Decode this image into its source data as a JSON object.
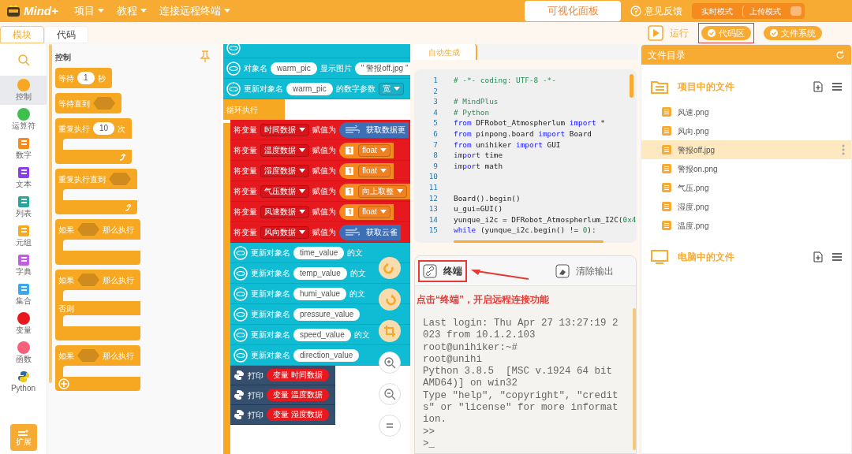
{
  "menu_bar": {
    "logo": "Mind+",
    "menus": [
      "项目",
      "教程",
      "连接远程终端"
    ],
    "panel_button": "可视化面板",
    "feedback": "意见反馈",
    "modes": [
      {
        "label": "实时模式",
        "selected": false
      },
      {
        "label": "上传模式",
        "selected": false
      }
    ]
  },
  "tabs": [
    {
      "label": "模块",
      "selected": true
    },
    {
      "label": "代码",
      "selected": false
    }
  ],
  "toolbar": {
    "run": "运行",
    "toggles": [
      {
        "label": "代码区",
        "on": true,
        "highlighted": true
      },
      {
        "label": "文件系统",
        "on": true,
        "highlighted": false
      }
    ]
  },
  "categories": [
    {
      "label": "控制",
      "kind": "dot",
      "color": "#f7a823",
      "selected": true
    },
    {
      "label": "运算符",
      "kind": "dot",
      "color": "#3fbf4f",
      "selected": false
    },
    {
      "label": "数字",
      "kind": "icon",
      "color": "#f58a1f",
      "selected": false
    },
    {
      "label": "文本",
      "kind": "icon",
      "color": "#8b3ee8",
      "selected": false
    },
    {
      "label": "列表",
      "kind": "icon",
      "color": "#2aa59a",
      "selected": false
    },
    {
      "label": "元组",
      "kind": "icon",
      "color": "#f7a823",
      "selected": false
    },
    {
      "label": "字典",
      "kind": "icon",
      "color": "#c060e0",
      "selected": false
    },
    {
      "label": "集合",
      "kind": "icon",
      "color": "#3aa8f0",
      "selected": false
    },
    {
      "label": "变量",
      "kind": "dot",
      "color": "#e8191e",
      "selected": false
    },
    {
      "label": "函数",
      "kind": "dot",
      "color": "#f7607a",
      "selected": false
    },
    {
      "label": "Python",
      "kind": "python",
      "color": "#2f6a9a",
      "selected": false
    }
  ],
  "extensions_button": "扩展",
  "palette": {
    "title": "控制",
    "blocks": [
      {
        "kind": "simple",
        "parts": [
          {
            "kind": "label",
            "text": "等待"
          },
          {
            "kind": "pill",
            "text": "1"
          },
          {
            "kind": "label",
            "text": "秒"
          }
        ]
      },
      {
        "kind": "simple",
        "parts": [
          {
            "kind": "label",
            "text": "等待直到"
          },
          {
            "kind": "hex"
          }
        ]
      },
      {
        "kind": "loop",
        "parts": [
          {
            "kind": "label",
            "text": "重复执行"
          },
          {
            "kind": "pill",
            "text": "10"
          },
          {
            "kind": "label",
            "text": "次"
          }
        ]
      },
      {
        "kind": "loop",
        "parts": [
          {
            "kind": "label",
            "text": "重复执行直到"
          },
          {
            "kind": "hex"
          }
        ]
      },
      {
        "kind": "if",
        "parts": [
          {
            "kind": "label",
            "text": "如果"
          },
          {
            "kind": "hex"
          },
          {
            "kind": "label",
            "text": "那么执行"
          }
        ]
      },
      {
        "kind": "ifelse",
        "parts": [
          {
            "kind": "label",
            "text": "如果"
          },
          {
            "kind": "hex"
          },
          {
            "kind": "label",
            "text": "那么执行"
          }
        ],
        "else": "否则"
      },
      {
        "kind": "ifplus",
        "parts": [
          {
            "kind": "label",
            "text": "如果"
          },
          {
            "kind": "hex"
          },
          {
            "kind": "label",
            "text": "那么执行"
          }
        ]
      }
    ]
  },
  "workspace": {
    "blocks": [
      {
        "kind": "cyan"
      },
      {
        "kind": "cyan",
        "parts": [
          {
            "kind": "label",
            "text": "对象名"
          },
          {
            "kind": "pill",
            "text": "warm_pic"
          },
          {
            "kind": "label",
            "text": "显示图片"
          },
          {
            "kind": "pill",
            "text": "\" 警报off.jpg \""
          }
        ]
      },
      {
        "kind": "cyan",
        "parts": [
          {
            "kind": "label",
            "text": "更新对象名"
          },
          {
            "kind": "pill",
            "text": "warm_pic"
          },
          {
            "kind": "label",
            "text": "的数字参数"
          },
          {
            "kind": "dropdown",
            "text": "宽"
          }
        ]
      },
      {
        "kind": "hat",
        "parts": [
          {
            "kind": "label",
            "text": "循环执行"
          }
        ]
      },
      {
        "kind": "red",
        "parts": [
          {
            "kind": "label",
            "text": "将变量"
          },
          {
            "kind": "dropdown",
            "text": "时间数据"
          },
          {
            "kind": "label",
            "text": "赋值为"
          },
          {
            "kind": "reporter",
            "text": "获取数据更"
          }
        ]
      },
      {
        "kind": "red",
        "parts": [
          {
            "kind": "label",
            "text": "将变量"
          },
          {
            "kind": "dropdown",
            "text": "温度数据"
          },
          {
            "kind": "label",
            "text": "赋值为"
          },
          {
            "kind": "number",
            "text": "float"
          }
        ]
      },
      {
        "kind": "red",
        "parts": [
          {
            "kind": "label",
            "text": "将变量"
          },
          {
            "kind": "dropdown",
            "text": "湿度数据"
          },
          {
            "kind": "label",
            "text": "赋值为"
          },
          {
            "kind": "number",
            "text": "float"
          }
        ]
      },
      {
        "kind": "red",
        "parts": [
          {
            "kind": "label",
            "text": "将变量"
          },
          {
            "kind": "dropdown",
            "text": "气压数据"
          },
          {
            "kind": "label",
            "text": "赋值为"
          },
          {
            "kind": "number",
            "text": "向上取整"
          }
        ]
      },
      {
        "kind": "red",
        "parts": [
          {
            "kind": "label",
            "text": "将变量"
          },
          {
            "kind": "dropdown",
            "text": "风速数据"
          },
          {
            "kind": "label",
            "text": "赋值为"
          },
          {
            "kind": "number",
            "text": "float"
          }
        ]
      },
      {
        "kind": "red",
        "parts": [
          {
            "kind": "label",
            "text": "将变量"
          },
          {
            "kind": "dropdown",
            "text": "风向数据"
          },
          {
            "kind": "label",
            "text": "赋值为"
          },
          {
            "kind": "reporter",
            "text": "获取云雀"
          }
        ]
      },
      {
        "kind": "cyan2",
        "parts": [
          {
            "kind": "label",
            "text": "更新对象名"
          },
          {
            "kind": "pill",
            "text": "time_value"
          },
          {
            "kind": "label",
            "text": "的文"
          }
        ]
      },
      {
        "kind": "cyan2",
        "parts": [
          {
            "kind": "label",
            "text": "更新对象名"
          },
          {
            "kind": "pill",
            "text": "temp_value"
          },
          {
            "kind": "label",
            "text": "的文"
          }
        ]
      },
      {
        "kind": "cyan2",
        "parts": [
          {
            "kind": "label",
            "text": "更新对象名"
          },
          {
            "kind": "pill",
            "text": "humi_value"
          },
          {
            "kind": "label",
            "text": "的文"
          }
        ]
      },
      {
        "kind": "cyan2",
        "parts": [
          {
            "kind": "label",
            "text": "更新对象名"
          },
          {
            "kind": "pill",
            "text": "pressure_value"
          }
        ]
      },
      {
        "kind": "cyan2",
        "parts": [
          {
            "kind": "label",
            "text": "更新对象名"
          },
          {
            "kind": "pill",
            "text": "speed_value"
          },
          {
            "kind": "label",
            "text": "的文"
          }
        ]
      },
      {
        "kind": "cyan2",
        "parts": [
          {
            "kind": "label",
            "text": "更新对象名"
          },
          {
            "kind": "pill",
            "text": "direction_value"
          }
        ]
      },
      {
        "kind": "print",
        "parts": [
          {
            "kind": "label",
            "text": "打印"
          },
          {
            "kind": "var",
            "text": "变量 时间数据"
          }
        ]
      },
      {
        "kind": "print",
        "parts": [
          {
            "kind": "label",
            "text": "打印"
          },
          {
            "kind": "var",
            "text": "变量 温度数据"
          }
        ]
      },
      {
        "kind": "print",
        "parts": [
          {
            "kind": "label",
            "text": "打印"
          },
          {
            "kind": "var",
            "text": "变量 湿度数据"
          }
        ]
      }
    ]
  },
  "code_panel": {
    "tab": "自动生成",
    "lines": [
      {
        "number": "1",
        "segments": [
          {
            "kind": "comment",
            "text": "#  -*- coding: UTF-8 -*-"
          }
        ]
      },
      {
        "number": "2"
      },
      {
        "number": "3",
        "segments": [
          {
            "kind": "comment",
            "text": "# MindPlus"
          }
        ]
      },
      {
        "number": "4",
        "segments": [
          {
            "kind": "comment",
            "text": "# Python"
          }
        ]
      },
      {
        "number": "5",
        "segments": [
          {
            "kind": "keyword",
            "text": "from"
          },
          {
            "kind": "plain",
            "text": " DFRobot_Atmospherlum "
          },
          {
            "kind": "keyword",
            "text": "import"
          },
          {
            "kind": "plain",
            "text": " *"
          }
        ]
      },
      {
        "number": "6",
        "segments": [
          {
            "kind": "keyword",
            "text": "from"
          },
          {
            "kind": "plain",
            "text": " pinpong.board "
          },
          {
            "kind": "keyword",
            "text": "import"
          },
          {
            "kind": "plain",
            "text": " Board"
          }
        ]
      },
      {
        "number": "7",
        "segments": [
          {
            "kind": "keyword",
            "text": "from"
          },
          {
            "kind": "plain",
            "text": " unihiker "
          },
          {
            "kind": "keyword",
            "text": "import"
          },
          {
            "kind": "plain",
            "text": " GUI"
          }
        ]
      },
      {
        "number": "8",
        "segments": [
          {
            "kind": "keyword",
            "text": "import"
          },
          {
            "kind": "plain",
            "text": " time"
          }
        ]
      },
      {
        "number": "9",
        "segments": [
          {
            "kind": "keyword",
            "text": "import"
          },
          {
            "kind": "plain",
            "text": " math"
          }
        ]
      },
      {
        "number": "10"
      },
      {
        "number": "11"
      },
      {
        "number": "12",
        "segments": [
          {
            "kind": "plain",
            "text": "Board().begin()"
          }
        ]
      },
      {
        "number": "13",
        "segments": [
          {
            "kind": "plain",
            "text": "u_gui=GUI()"
          }
        ]
      },
      {
        "number": "14",
        "segments": [
          {
            "kind": "plain",
            "text": "yunque_i2c = DFRobot_Atmospherlum_I2C("
          },
          {
            "kind": "number",
            "text": "0x4"
          }
        ]
      },
      {
        "number": "15",
        "segments": [
          {
            "kind": "keyword",
            "text": "while"
          },
          {
            "kind": "plain",
            "text": " (yunque_i2c.begin() != "
          },
          {
            "kind": "number",
            "text": "0"
          },
          {
            "kind": "plain",
            "text": "):"
          }
        ]
      }
    ]
  },
  "terminal": {
    "terminal_button": "终端",
    "clear_button": "清除输出",
    "annotation": "点击“终端”，开启远程连接功能",
    "lines": [
      "Last login: Thu Apr 27 13:27:19 2",
      "023 from 10.1.2.103",
      "root@unihiker:~#",
      "root@unihi",
      "Python 3.8.5  [MSC v.1924 64 bit",
      "AMD64)] on win32",
      "Type \"help\", \"copyright\", \"credit",
      "s\" or \"license\" for more informat",
      "ion.",
      ">>",
      ">_"
    ]
  },
  "file_panel": {
    "title": "文件目录",
    "sections": [
      {
        "title": "项目中的文件",
        "kind": "project",
        "files": [
          {
            "name": "风速.png",
            "selected": false
          },
          {
            "name": "风向.png",
            "selected": false
          },
          {
            "name": "警报off.jpg",
            "selected": true
          },
          {
            "name": "警报on.png",
            "selected": false
          },
          {
            "name": "气压.png",
            "selected": false
          },
          {
            "name": "湿度.png",
            "selected": false
          },
          {
            "name": "温度.png",
            "selected": false
          }
        ]
      },
      {
        "title": "电脑中的文件",
        "kind": "computer"
      }
    ]
  }
}
